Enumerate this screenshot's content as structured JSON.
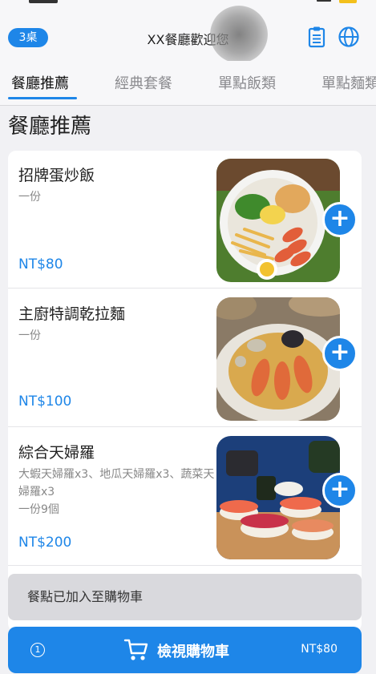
{
  "header": {
    "table_badge": "3桌",
    "title": "XX餐廳歡迎您"
  },
  "tabs": [
    {
      "label": "餐廳推薦",
      "active": true
    },
    {
      "label": "經典套餐",
      "active": false
    },
    {
      "label": "單點飯類",
      "active": false
    },
    {
      "label": "單點麵類",
      "active": false
    }
  ],
  "section_title": "餐廳推薦",
  "items": [
    {
      "name": "招牌蛋炒飯",
      "desc": "一份",
      "price": "NT$80"
    },
    {
      "name": "主廚特調乾拉麵",
      "desc": "一份",
      "price": "NT$100"
    },
    {
      "name": "綜合天婦羅",
      "desc": "大蝦天婦羅x3、地瓜天婦羅x3、蔬菜天婦羅x3\n一份9個",
      "price": "NT$200"
    }
  ],
  "toast": "餐點已加入至購物車",
  "cart": {
    "count": "1",
    "label": "檢視購物車",
    "total": "NT$80"
  },
  "colors": {
    "accent": "#1e86e8",
    "toast_bg": "#d9d9dd"
  }
}
